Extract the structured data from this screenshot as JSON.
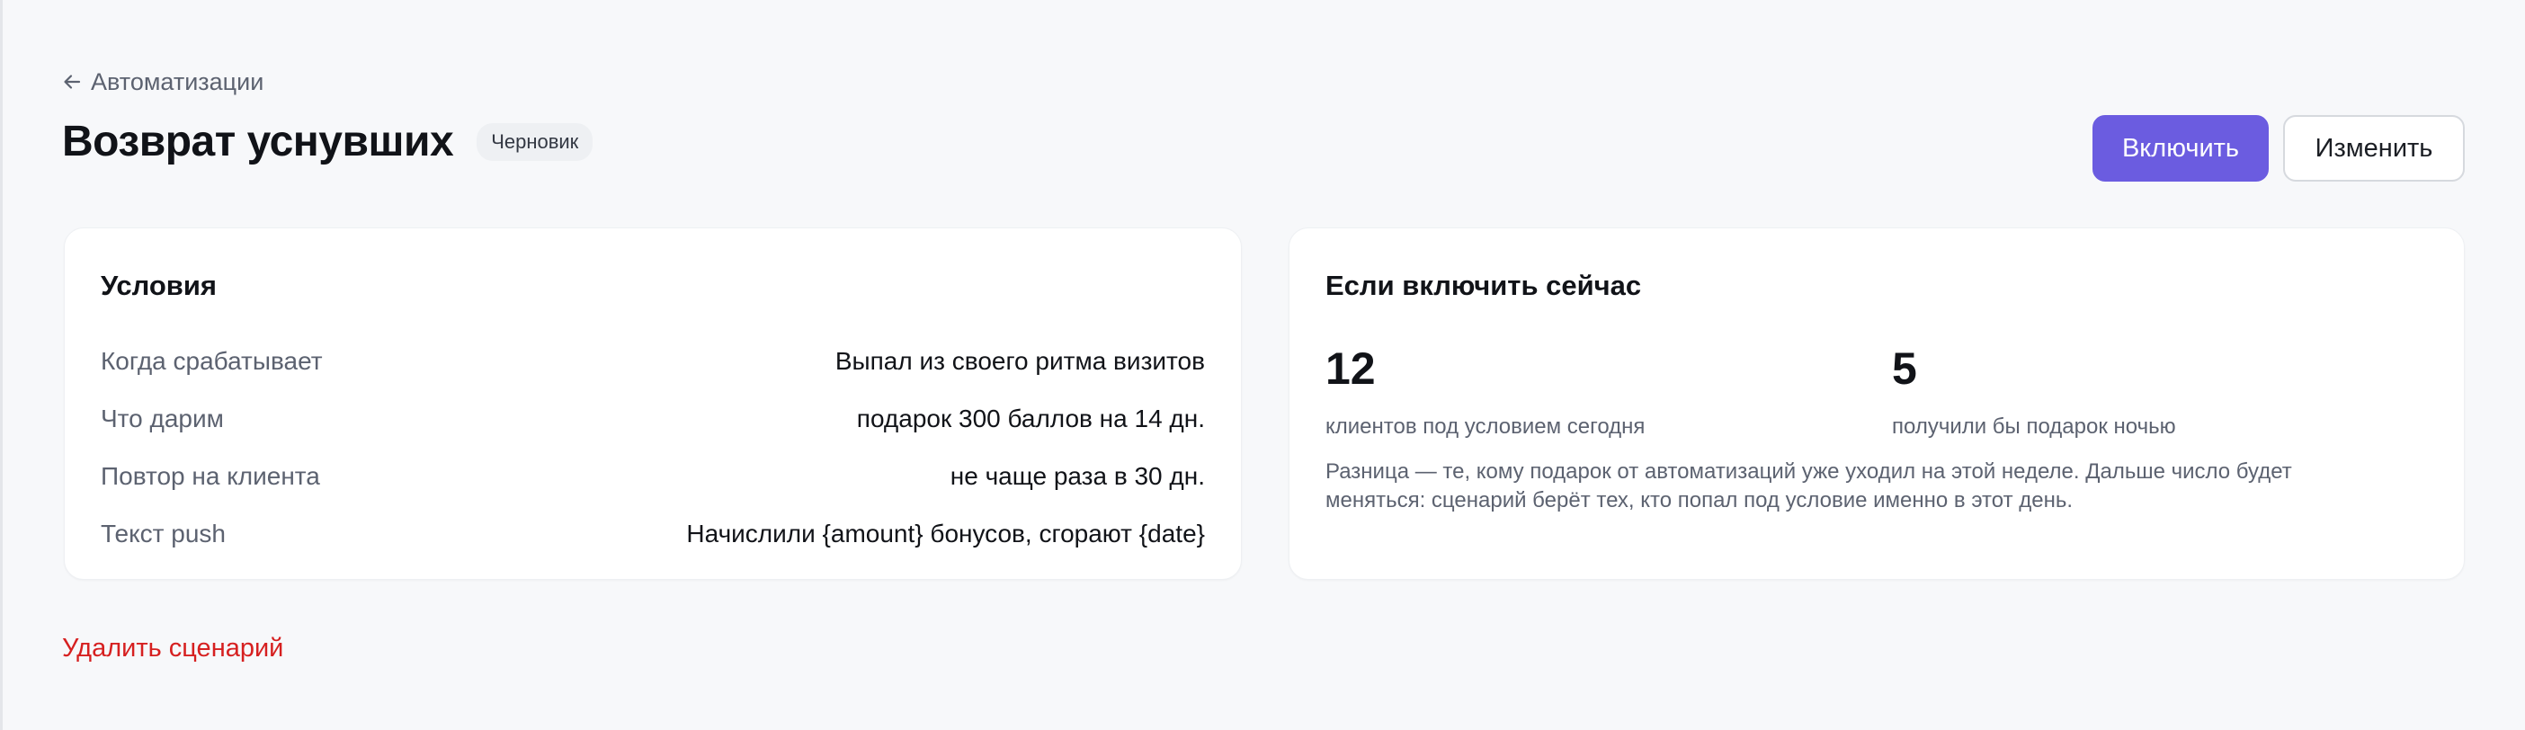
{
  "breadcrumb": {
    "label": "Автоматизации"
  },
  "header": {
    "title": "Возврат уснувших",
    "status": "Черновик",
    "enable_label": "Включить",
    "edit_label": "Изменить"
  },
  "conditions": {
    "title": "Условия",
    "rows": [
      {
        "label": "Когда срабатывает",
        "value": "Выпал из своего ритма визитов"
      },
      {
        "label": "Что дарим",
        "value": "подарок 300 баллов на 14 дн."
      },
      {
        "label": "Повтор на клиента",
        "value": "не чаще раза в 30 дн."
      },
      {
        "label": "Текст push",
        "value": "Начислили {amount} бонусов, сгорают {date}"
      }
    ]
  },
  "forecast": {
    "title": "Если включить сейчас",
    "metrics": [
      {
        "value": "12",
        "label": "клиентов под условием сегодня"
      },
      {
        "value": "5",
        "label": "получили бы подарок ночью"
      }
    ],
    "note": "Разница — те, кому подарок от автоматизаций уже уходил на этой неделе. Дальше число будет меняться: сценарий берёт тех, кто попал под условие именно в этот день."
  },
  "footer": {
    "delete_label": "Удалить сценарий"
  },
  "colors": {
    "accent": "#6b5ce0",
    "danger": "#d62020",
    "background": "#f7f8fa",
    "muted_text": "#5c6270"
  },
  "icons": {
    "back": "arrow-left-icon"
  }
}
